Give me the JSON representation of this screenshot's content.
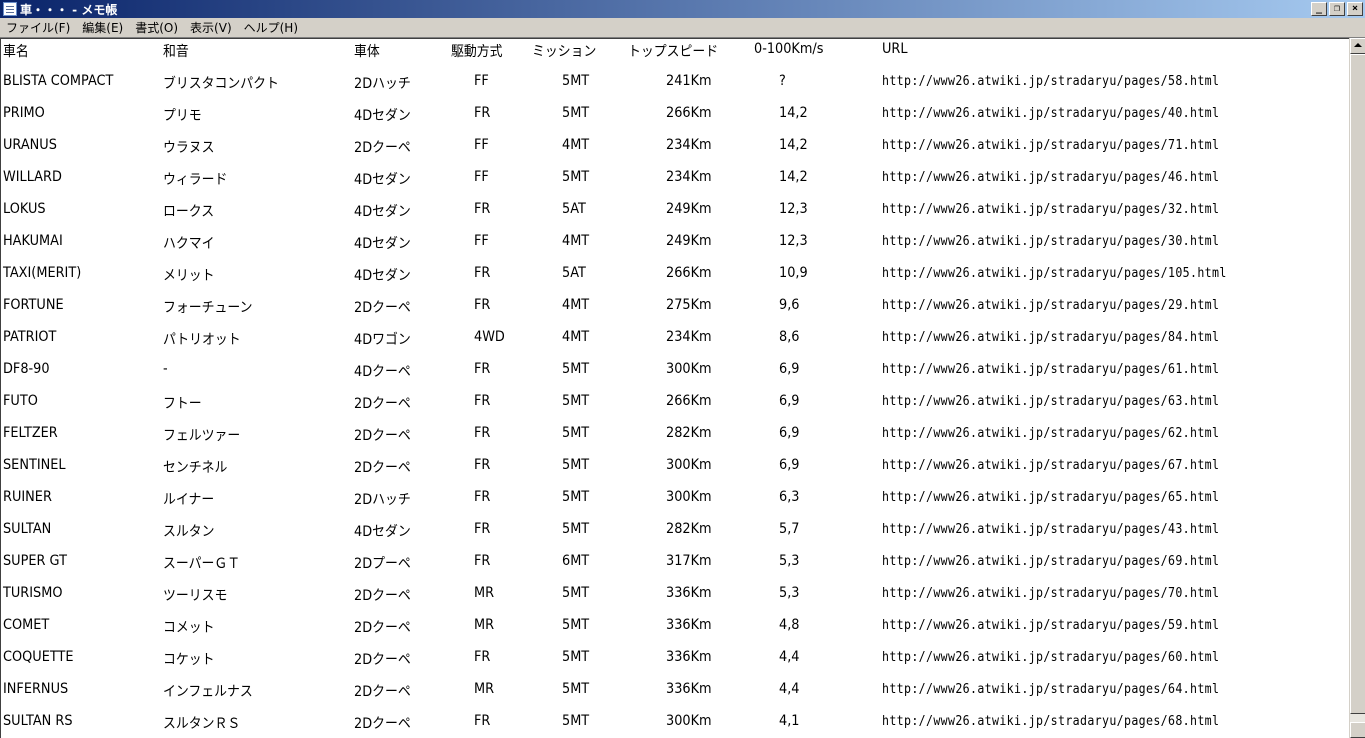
{
  "window": {
    "title": "車・・・ - メモ帳",
    "icon": "notepad-icon",
    "buttons": {
      "minimize": "_",
      "restore": "❐",
      "close": "×"
    }
  },
  "menu": {
    "items": [
      {
        "label": "ファイル(F)"
      },
      {
        "label": "編集(E)"
      },
      {
        "label": "書式(O)"
      },
      {
        "label": "表示(V)"
      },
      {
        "label": "ヘルプ(H)"
      }
    ]
  },
  "table": {
    "headers": {
      "name": "車名",
      "jp": "和音",
      "body": "車体",
      "drive": "駆動方式",
      "mission": "ミッション",
      "speed": "トップスピード",
      "acc": "0-100Km/s",
      "url": "URL"
    },
    "rows": [
      {
        "name": "BLISTA COMPACT",
        "jp": "ブリスタコンパクト",
        "body": "2Dハッチ",
        "drive": "FF",
        "mission": "5MT",
        "speed": "241Km",
        "acc": "?",
        "url": "http://www26.atwiki.jp/stradaryu/pages/58.html"
      },
      {
        "name": "PRIMO",
        "jp": "プリモ",
        "body": "4Dセダン",
        "drive": "FR",
        "mission": "5MT",
        "speed": "266Km",
        "acc": "14,2",
        "url": "http://www26.atwiki.jp/stradaryu/pages/40.html"
      },
      {
        "name": "URANUS",
        "jp": "ウラヌス",
        "body": "2Dクーペ",
        "drive": "FF",
        "mission": "4MT",
        "speed": "234Km",
        "acc": "14,2",
        "url": "http://www26.atwiki.jp/stradaryu/pages/71.html"
      },
      {
        "name": "WILLARD",
        "jp": "ウィラード",
        "body": "4Dセダン",
        "drive": "FF",
        "mission": "5MT",
        "speed": "234Km",
        "acc": "14,2",
        "url": "http://www26.atwiki.jp/stradaryu/pages/46.html"
      },
      {
        "name": "LOKUS",
        "jp": "ロークス",
        "body": "4Dセダン",
        "drive": "FR",
        "mission": "5AT",
        "speed": "249Km",
        "acc": "12,3",
        "url": "http://www26.atwiki.jp/stradaryu/pages/32.html"
      },
      {
        "name": "HAKUMAI",
        "jp": "ハクマイ",
        "body": "4Dセダン",
        "drive": "FF",
        "mission": "4MT",
        "speed": "249Km",
        "acc": "12,3",
        "url": "http://www26.atwiki.jp/stradaryu/pages/30.html"
      },
      {
        "name": "TAXI(MERIT)",
        "jp": "メリット",
        "body": "4Dセダン",
        "drive": "FR",
        "mission": "5AT",
        "speed": "266Km",
        "acc": "10,9",
        "url": "http://www26.atwiki.jp/stradaryu/pages/105.html"
      },
      {
        "name": "FORTUNE",
        "jp": "フォーチューン",
        "body": "2Dクーペ",
        "drive": "FR",
        "mission": "4MT",
        "speed": "275Km",
        "acc": "9,6",
        "url": "http://www26.atwiki.jp/stradaryu/pages/29.html"
      },
      {
        "name": "PATRIOT",
        "jp": "パトリオット",
        "body": "4Dワゴン",
        "drive": "4WD",
        "mission": "4MT",
        "speed": "234Km",
        "acc": "8,6",
        "url": "http://www26.atwiki.jp/stradaryu/pages/84.html"
      },
      {
        "name": "DF8-90",
        "jp": "-",
        "body": "4Dクーペ",
        "drive": "FR",
        "mission": "5MT",
        "speed": "300Km",
        "acc": "6,9",
        "url": "http://www26.atwiki.jp/stradaryu/pages/61.html"
      },
      {
        "name": "FUTO",
        "jp": "フトー",
        "body": "2Dクーペ",
        "drive": "FR",
        "mission": "5MT",
        "speed": "266Km",
        "acc": "6,9",
        "url": "http://www26.atwiki.jp/stradaryu/pages/63.html"
      },
      {
        "name": "FELTZER",
        "jp": "フェルツァー",
        "body": "2Dクーペ",
        "drive": "FR",
        "mission": "5MT",
        "speed": "282Km",
        "acc": "6,9",
        "url": "http://www26.atwiki.jp/stradaryu/pages/62.html"
      },
      {
        "name": "SENTINEL",
        "jp": "センチネル",
        "body": "2Dクーペ",
        "drive": "FR",
        "mission": "5MT",
        "speed": "300Km",
        "acc": "6,9",
        "url": "http://www26.atwiki.jp/stradaryu/pages/67.html"
      },
      {
        "name": "RUINER",
        "jp": "ルイナー",
        "body": "2Dハッチ",
        "drive": "FR",
        "mission": "5MT",
        "speed": "300Km",
        "acc": "6,3",
        "url": "http://www26.atwiki.jp/stradaryu/pages/65.html"
      },
      {
        "name": "SULTAN",
        "jp": "スルタン",
        "body": "4Dセダン",
        "drive": "FR",
        "mission": "5MT",
        "speed": "282Km",
        "acc": "5,7",
        "url": "http://www26.atwiki.jp/stradaryu/pages/43.html"
      },
      {
        "name": "SUPER GT",
        "jp": "スーパーＧＴ",
        "body": "2Dプーペ",
        "drive": "FR",
        "mission": "6MT",
        "speed": "317Km",
        "acc": "5,3",
        "url": "http://www26.atwiki.jp/stradaryu/pages/69.html"
      },
      {
        "name": "TURISMO",
        "jp": "ツーリスモ",
        "body": "2Dクーペ",
        "drive": "MR",
        "mission": "5MT",
        "speed": "336Km",
        "acc": "5,3",
        "url": "http://www26.atwiki.jp/stradaryu/pages/70.html"
      },
      {
        "name": "COMET",
        "jp": "コメット",
        "body": "2Dクーペ",
        "drive": "MR",
        "mission": "5MT",
        "speed": "336Km",
        "acc": "4,8",
        "url": "http://www26.atwiki.jp/stradaryu/pages/59.html"
      },
      {
        "name": "COQUETTE",
        "jp": "コケット",
        "body": "2Dクーペ",
        "drive": "FR",
        "mission": "5MT",
        "speed": "336Km",
        "acc": "4,4",
        "url": "http://www26.atwiki.jp/stradaryu/pages/60.html"
      },
      {
        "name": "INFERNUS",
        "jp": "インフェルナス",
        "body": "2Dクーペ",
        "drive": "MR",
        "mission": "5MT",
        "speed": "336Km",
        "acc": "4,4",
        "url": "http://www26.atwiki.jp/stradaryu/pages/64.html"
      },
      {
        "name": "SULTAN RS",
        "jp": "スルタンＲＳ",
        "body": "2Dクーペ",
        "drive": "FR",
        "mission": "5MT",
        "speed": "300Km",
        "acc": "4,1",
        "url": "http://www26.atwiki.jp/stradaryu/pages/68.html"
      }
    ]
  }
}
